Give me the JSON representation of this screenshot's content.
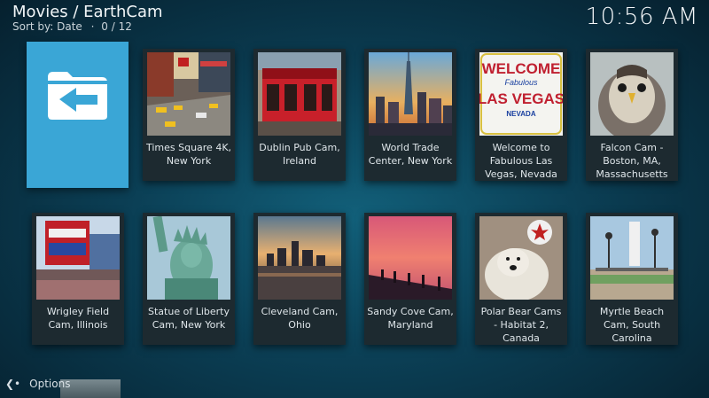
{
  "header": {
    "title": "Movies / EarthCam",
    "sort_label": "Sort by: Date",
    "separator": "·",
    "count": "0 / 12",
    "clock": "10:56 AM"
  },
  "back_tile": {
    "icon": "folder-back-icon",
    "color": "#3aa6d6"
  },
  "items": [
    {
      "label": "Times Square 4K, New York"
    },
    {
      "label": "Dublin Pub Cam, Ireland"
    },
    {
      "label": "World Trade Center, New York"
    },
    {
      "label": "Welcome to Fabulous Las Vegas, Nevada",
      "thumb_text": "WELCOME",
      "thumb_text2": "Fabulous",
      "thumb_text3": "LAS VEGAS",
      "thumb_text4": "NEVADA"
    },
    {
      "label": "Falcon Cam - Boston, MA, Massachusetts"
    },
    {
      "label": "Wrigley Field Cam, Illinois"
    },
    {
      "label": "Statue of Liberty Cam, New York"
    },
    {
      "label": "Cleveland Cam, Ohio"
    },
    {
      "label": "Sandy Cove Cam, Maryland"
    },
    {
      "label": "Polar Bear Cams - Habitat 2, Canada"
    },
    {
      "label": "Myrtle Beach Cam, South Carolina"
    }
  ],
  "footer": {
    "options_label": "Options",
    "options_icon": "options-chevron-icon"
  }
}
